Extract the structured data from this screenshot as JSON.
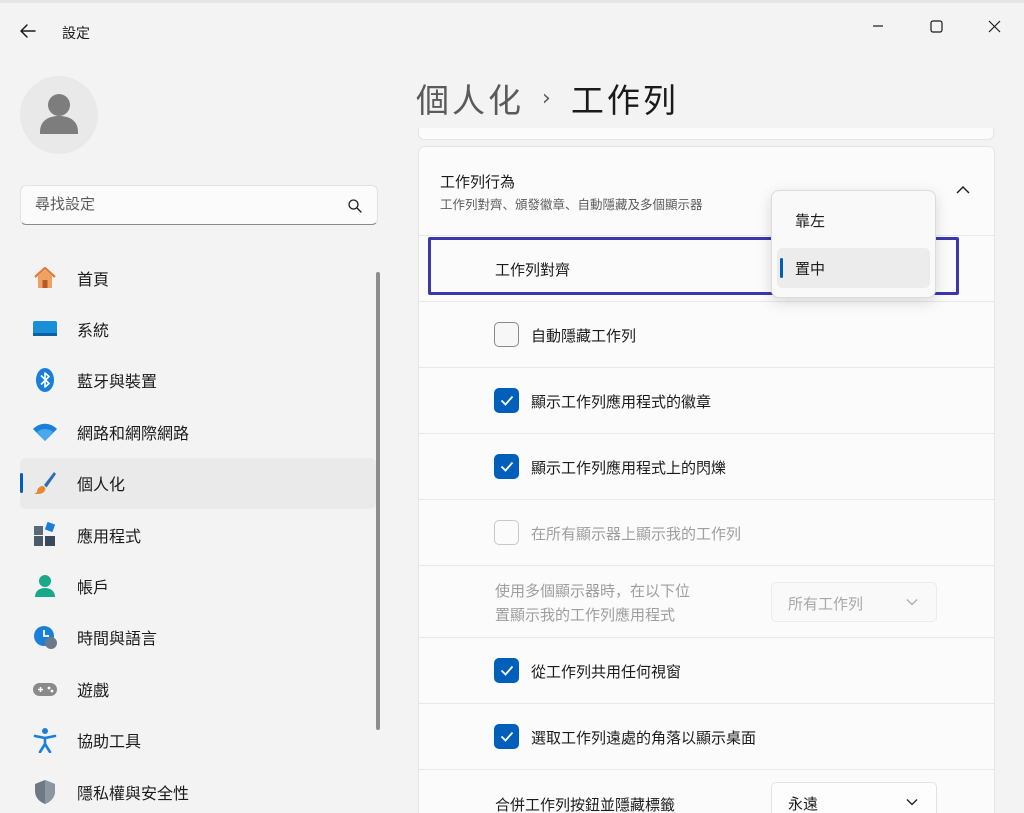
{
  "app": {
    "title": "設定"
  },
  "search": {
    "placeholder": "尋找設定"
  },
  "sidebar": {
    "items": [
      {
        "label": "首頁",
        "icon": "home-icon"
      },
      {
        "label": "系統",
        "icon": "system-icon"
      },
      {
        "label": "藍牙與裝置",
        "icon": "bluetooth-icon"
      },
      {
        "label": "網路和網際網路",
        "icon": "wifi-icon"
      },
      {
        "label": "個人化",
        "icon": "paintbrush-icon",
        "selected": true
      },
      {
        "label": "應用程式",
        "icon": "apps-icon"
      },
      {
        "label": "帳戶",
        "icon": "account-icon"
      },
      {
        "label": "時間與語言",
        "icon": "time-language-icon"
      },
      {
        "label": "遊戲",
        "icon": "gamepad-icon"
      },
      {
        "label": "協助工具",
        "icon": "accessibility-icon"
      },
      {
        "label": "隱私權與安全性",
        "icon": "shield-icon"
      }
    ]
  },
  "breadcrumb": {
    "parent": "個人化",
    "separator": "›",
    "current": "工作列"
  },
  "section": {
    "title": "工作列行為",
    "description": "工作列對齊、頒發徽章、自動隱藏及多個顯示器"
  },
  "alignment": {
    "label": "工作列對齊",
    "options": [
      "靠左",
      "置中"
    ],
    "selected": "置中"
  },
  "options": [
    {
      "label": "自動隱藏工作列",
      "checked": false,
      "disabled": false
    },
    {
      "label": "顯示工作列應用程式的徽章",
      "checked": true,
      "disabled": false
    },
    {
      "label": "顯示工作列應用程式上的閃爍",
      "checked": true,
      "disabled": false
    },
    {
      "label": "在所有顯示器上顯示我的工作列",
      "checked": false,
      "disabled": true
    }
  ],
  "multi_display": {
    "label_line1": "使用多個顯示器時，在以下位",
    "label_line2": "置顯示我的工作列應用程式",
    "value": "所有工作列",
    "disabled": true
  },
  "options2": [
    {
      "label": "從工作列共用任何視窗",
      "checked": true
    },
    {
      "label": "選取工作列遠處的角落以顯示桌面",
      "checked": true
    }
  ],
  "combine": {
    "label": "合併工作列按鈕並隱藏標籤",
    "value": "永遠"
  },
  "colors": {
    "accent": "#005fb8",
    "highlight": "#3c37ad"
  }
}
